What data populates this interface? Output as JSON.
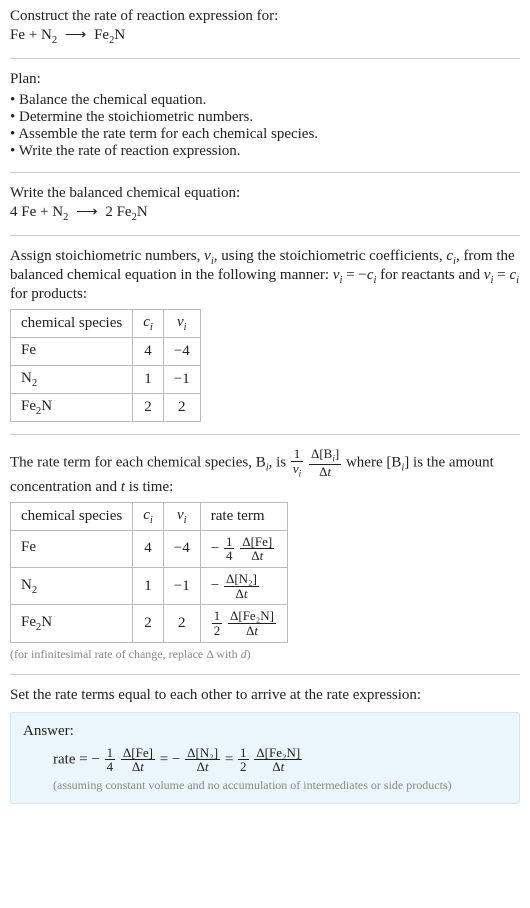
{
  "prompt": "Construct the rate of reaction expression for:",
  "unbalanced": {
    "lhs1": "Fe",
    "plus": " + ",
    "lhs2": "N",
    "lhs2sub": "2",
    "arrow": "⟶",
    "rhs1": "Fe",
    "rhs1sub": "2",
    "rhs2": "N"
  },
  "plan_label": "Plan:",
  "plan": [
    "Balance the chemical equation.",
    "Determine the stoichiometric numbers.",
    "Assemble the rate term for each chemical species.",
    "Write the rate of reaction expression."
  ],
  "balanced_label": "Write the balanced chemical equation:",
  "balanced": {
    "c1": "4",
    "s1": "Fe",
    "plus": " + ",
    "s2": "N",
    "s2sub": "2",
    "arrow": "⟶",
    "c3": "2",
    "s3": "Fe",
    "s3sub": "2",
    "s3b": "N"
  },
  "assign_text_a": "Assign stoichiometric numbers, ",
  "assign_text_b": ", using the stoichiometric coefficients, ",
  "assign_text_c": ", from the balanced chemical equation in the following manner: ",
  "assign_text_d": " for reactants and ",
  "assign_text_e": " for products:",
  "nu_i": "ν",
  "nu_i_sub": "i",
  "c_i": "c",
  "c_i_sub": "i",
  "eq_reactants_lhs": "ν",
  "eq_reactants_lhs_sub": "i",
  "eq_reactants_mid": " = −",
  "eq_reactants_rhs": "c",
  "eq_reactants_rhs_sub": "i",
  "eq_products_lhs": "ν",
  "eq_products_lhs_sub": "i",
  "eq_products_mid": " = ",
  "eq_products_rhs": "c",
  "eq_products_rhs_sub": "i",
  "table1": {
    "h1": "chemical species",
    "h2": "c",
    "h2sub": "i",
    "h3": "ν",
    "h3sub": "i",
    "rows": [
      {
        "sp": "Fe",
        "spsub": "",
        "c": "4",
        "nu": "−4"
      },
      {
        "sp": "N",
        "spsub": "2",
        "c": "1",
        "nu": "−1"
      },
      {
        "sp": "Fe",
        "spsub": "2",
        "sp2": "N",
        "c": "2",
        "nu": "2"
      }
    ]
  },
  "rate_intro_a": "The rate term for each chemical species, B",
  "rate_intro_a_sub": "i",
  "rate_intro_b": ", is ",
  "rate_frac1_num": "1",
  "rate_frac1_den_sym": "ν",
  "rate_frac1_den_sub": "i",
  "rate_frac2_num": "Δ[B",
  "rate_frac2_num_sub": "i",
  "rate_frac2_num_close": "]",
  "rate_frac2_den": "Δt",
  "rate_intro_c": " where [B",
  "rate_intro_c_sub": "i",
  "rate_intro_d": "] is the amount concentration and ",
  "rate_intro_t": "t",
  "rate_intro_e": " is time:",
  "table2": {
    "h1": "chemical species",
    "h2": "c",
    "h2sub": "i",
    "h3": "ν",
    "h3sub": "i",
    "h4": "rate term",
    "rows": [
      {
        "sp": "Fe",
        "spsub": "",
        "c": "4",
        "nu": "−4",
        "neg": "−",
        "coef_num": "1",
        "coef_den": "4",
        "d_num": "Δ[Fe]",
        "d_den": "Δt"
      },
      {
        "sp": "N",
        "spsub": "2",
        "c": "1",
        "nu": "−1",
        "neg": "−",
        "coef_num": "",
        "coef_den": "",
        "d_num": "Δ[N₂]",
        "d_den": "Δt"
      },
      {
        "sp": "Fe",
        "spsub": "2",
        "sp2": "N",
        "c": "2",
        "nu": "2",
        "neg": "",
        "coef_num": "1",
        "coef_den": "2",
        "d_num": "Δ[Fe₂N]",
        "d_den": "Δt"
      }
    ]
  },
  "infinitesimal_note": "(for infinitesimal rate of change, replace Δ with d)",
  "set_equal": "Set the rate terms equal to each other to arrive at the rate expression:",
  "answer": {
    "label": "Answer:",
    "rate_word": "rate = ",
    "t1_neg": "−",
    "t1_cnum": "1",
    "t1_cden": "4",
    "t1_num": "Δ[Fe]",
    "t1_den": "Δt",
    "eq1": " = ",
    "t2_neg": "−",
    "t2_num": "Δ[N₂]",
    "t2_den": "Δt",
    "eq2": " = ",
    "t3_cnum": "1",
    "t3_cden": "2",
    "t3_num": "Δ[Fe₂N]",
    "t3_den": "Δt",
    "assume": "(assuming constant volume and no accumulation of intermediates or side products)"
  }
}
